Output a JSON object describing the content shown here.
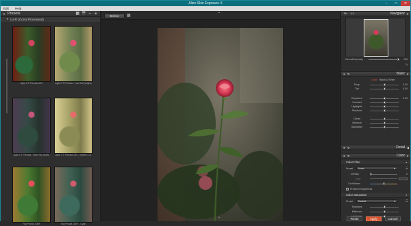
{
  "app": {
    "title": "Alien Skin Exposure X"
  },
  "menu": [
    "Edit",
    "Help"
  ],
  "presets": {
    "title": "Presets",
    "group": "Lo-Fi (Cross Processed)",
    "items": [
      {
        "label": "Agfa CT Precisa 100"
      },
      {
        "label": "Agfa CT Precisa - Low Sat (bright)"
      },
      {
        "label": "Agfa CT Precisa - Blue Sky (dark)"
      },
      {
        "label": "Agfa CT Precisa 100 - Some LCA"
      },
      {
        "label": "Fuji Provia 100F"
      },
      {
        "label": "Fuji Provia 100F - Cyan"
      }
    ]
  },
  "toolbar": {
    "before_label": "Before"
  },
  "navigator": {
    "title": "Navigator",
    "fit": "Fit",
    "ratio": "1:1",
    "intensity_label": "Overall Intensity",
    "intensity_value": "100"
  },
  "basic": {
    "title": "Basic",
    "mode_color": "Color",
    "mode_bw": "Black & White",
    "sliders": [
      {
        "label": "Temp",
        "value": "0.00",
        "pos": 0.5
      },
      {
        "label": "Tint",
        "value": "0.00",
        "pos": 0.5
      },
      {
        "label": "Exposure",
        "value": "0.00",
        "pos": 0.5
      },
      {
        "label": "Contrast",
        "value": "",
        "pos": 0.5
      },
      {
        "label": "Highlights",
        "value": "",
        "pos": 0.5
      },
      {
        "label": "Shadows",
        "value": "",
        "pos": 0.5
      },
      {
        "label": "Clarity",
        "value": "",
        "pos": 0.5
      },
      {
        "label": "Vibrance",
        "value": "",
        "pos": 0.5
      },
      {
        "label": "Saturation",
        "value": "",
        "pos": 0.5
      }
    ]
  },
  "detail": {
    "title": "Detail"
  },
  "color": {
    "title": "Color",
    "filter_title": "Color Filter",
    "preset_label": "Preset",
    "preset_value": "None",
    "density_label": "Density",
    "density_value": "0",
    "color_label": "Color",
    "coolwarm_label": "Cool/Warm",
    "preserve_label": "Preserve Brightness",
    "sat_title": "Color Saturation",
    "sat_preset_value": "Neutral",
    "sat_rows": [
      "Shadows",
      "Midtones",
      "Highlights"
    ]
  },
  "actions": {
    "reset": "Reset",
    "apply": "Apply",
    "cancel": "Cancel"
  },
  "colors": {
    "accent": "#0c6f7e",
    "apply": "#d9532f"
  }
}
